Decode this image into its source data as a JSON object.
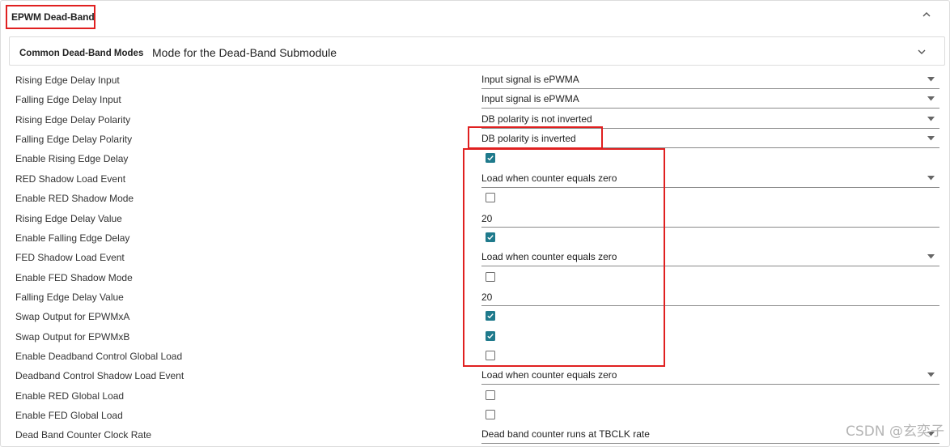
{
  "section": {
    "title": "EPWM Dead-Band",
    "subsection_title": "Common Dead-Band Modes",
    "subsection_desc": "Mode for the Dead-Band Submodule"
  },
  "rows": [
    {
      "label": "Rising Edge Delay Input",
      "type": "select",
      "value": "Input signal is ePWMA"
    },
    {
      "label": "Falling Edge Delay Input",
      "type": "select",
      "value": "Input signal is ePWMA"
    },
    {
      "label": "Rising Edge Delay Polarity",
      "type": "select",
      "value": "DB polarity is not inverted"
    },
    {
      "label": "Falling Edge Delay Polarity",
      "type": "select",
      "value": "DB polarity is inverted"
    },
    {
      "label": "Enable Rising Edge Delay",
      "type": "checkbox",
      "checked": true
    },
    {
      "label": "RED Shadow Load Event",
      "type": "select",
      "value": "Load when counter equals zero"
    },
    {
      "label": "Enable RED Shadow Mode",
      "type": "checkbox",
      "checked": false
    },
    {
      "label": "Rising Edge Delay Value",
      "type": "text",
      "value": "20"
    },
    {
      "label": "Enable Falling Edge Delay",
      "type": "checkbox",
      "checked": true
    },
    {
      "label": "FED Shadow Load Event",
      "type": "select",
      "value": "Load when counter equals zero"
    },
    {
      "label": "Enable FED Shadow Mode",
      "type": "checkbox",
      "checked": false
    },
    {
      "label": "Falling Edge Delay Value",
      "type": "text",
      "value": "20"
    },
    {
      "label": "Swap Output for EPWMxA",
      "type": "checkbox",
      "checked": true
    },
    {
      "label": "Swap Output for EPWMxB",
      "type": "checkbox",
      "checked": true
    },
    {
      "label": "Enable Deadband Control Global Load",
      "type": "checkbox",
      "checked": false
    },
    {
      "label": "Deadband Control Shadow Load Event",
      "type": "select",
      "value": "Load when counter equals zero"
    },
    {
      "label": "Enable RED Global Load",
      "type": "checkbox",
      "checked": false
    },
    {
      "label": "Enable FED Global Load",
      "type": "checkbox",
      "checked": false
    },
    {
      "label": "Dead Band Counter Clock Rate",
      "type": "select",
      "value": "Dead band counter runs at TBCLK rate"
    }
  ],
  "watermark": "CSDN @玄奕子",
  "colors": {
    "checkbox_checked": "#1f7a8c",
    "annotation": "#e02020"
  },
  "icons": {
    "collapse": "chevron-up-icon",
    "expand": "chevron-down-icon",
    "dropdown": "caret-down-icon",
    "check": "checkmark-icon"
  }
}
